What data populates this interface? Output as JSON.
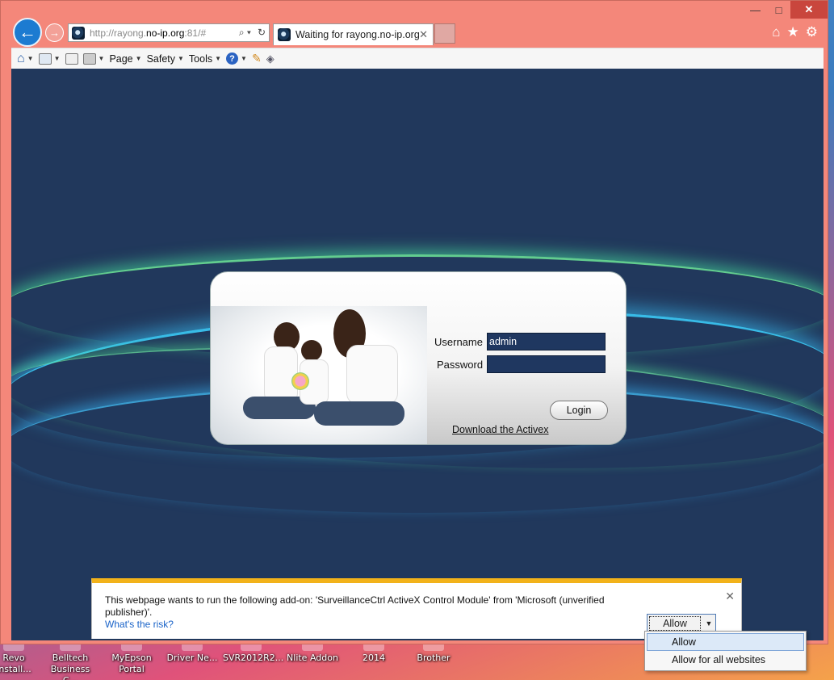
{
  "window": {
    "minimize_glyph": "—",
    "maximize_glyph": "□",
    "close_glyph": "✕"
  },
  "nav": {
    "back_glyph": "←",
    "forward_glyph": "→"
  },
  "address": {
    "url_prefix": "http://rayong.",
    "url_host": "no-ip.org",
    "url_suffix": ":81/#",
    "search_glyph": "⌕ ▾",
    "refresh_glyph": "↻"
  },
  "tab": {
    "title": "Waiting for rayong.no-ip.org",
    "close_glyph": "✕"
  },
  "right_icons": [
    "home-icon",
    "favorites-icon",
    "tools-gear-icon"
  ],
  "commandbar": {
    "page_label": "Page",
    "safety_label": "Safety",
    "tools_label": "Tools",
    "help_glyph": "?"
  },
  "login": {
    "username_label": "Username",
    "username_value": "admin",
    "password_label": "Password",
    "password_value": "",
    "login_button": "Login",
    "download_link": "Download the Activex"
  },
  "notification": {
    "message": "This webpage wants to run the following add-on: 'SurveillanceCtrl ActiveX Control Module' from 'Microsoft (unverified publisher)'.",
    "risk_link": "What's the risk?",
    "allow_button": "Allow",
    "close_glyph": "✕",
    "accent_color": "#f2b21a"
  },
  "allow_menu": {
    "items": [
      "Allow",
      "Allow for all websites"
    ],
    "selected_index": 0
  },
  "desktop_icons": [
    {
      "label": "Revo install..."
    },
    {
      "label": "Belltech Business C..."
    },
    {
      "label": "MyEpson Portal"
    },
    {
      "label": "Driver Ne..."
    },
    {
      "label": "SVR2012R2..."
    },
    {
      "label": "Nlite Addon"
    },
    {
      "label": "2014"
    },
    {
      "label": "Brother"
    }
  ],
  "colors": {
    "frame": "#f4877a",
    "page_bg": "#21385c",
    "back_button": "#1c7bd1"
  }
}
